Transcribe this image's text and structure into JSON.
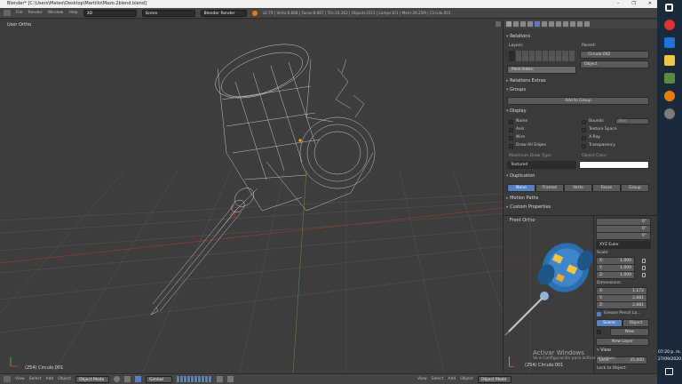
{
  "window": {
    "title": "Blender* [C:\\Users\\Mateo\\Desktop\\Martillo\\Mazo.2blend.blend]",
    "controls": [
      "–",
      "❐",
      "✕"
    ]
  },
  "menubar": {
    "items": [
      "File",
      "Render",
      "Window",
      "Help"
    ],
    "screen_layout": "3D",
    "scene": "Scene",
    "render_engine": "Blender Render",
    "version_icon": "blender-logo-icon",
    "stats": "v2.79 | Verts:8,888 | Faces:8,687 | Tris:16,362 | Objects:0/23 | Lamps:0/1 | Mem:39.25M | Circulo.001"
  },
  "viewport": {
    "view_label": "User Ortho",
    "object_label": "(254) Circulo.001"
  },
  "toolbar": {
    "items": [
      "View",
      "Select",
      "Add",
      "Object"
    ],
    "mode": "Object Mode",
    "orientation": "Gimbal"
  },
  "properties": {
    "sections": {
      "relations": "Relations",
      "relations_extras": "Relations Extras",
      "groups": "Groups",
      "display": "Display",
      "duplication": "Duplication",
      "motion_paths": "Motion Paths",
      "custom_properties": "Custom Properties"
    },
    "layers_label": "Layers:",
    "parent_label": "Parent:",
    "parent_value": "Circulo.002",
    "parent_type": "Object",
    "pass_index": "Pass Index:",
    "pass_index_value": "0",
    "add_to_group": "Add to Group",
    "display_options": {
      "name": "Name",
      "axis": "Axis",
      "wire": "Wire",
      "draw_all_edges": "Draw All Edges",
      "bounds": "Bounds",
      "bounds_type": "Box",
      "texture_space": "Texture Space",
      "xray": "X-Ray",
      "transparency": "Transparency"
    },
    "max_draw_type_label": "Maximum Draw Type:",
    "max_draw_type": "Textured",
    "object_color_label": "Object Color:",
    "duplication_buttons": [
      "None",
      "Frames",
      "Verts",
      "Faces",
      "Group"
    ],
    "duplication_active": "None"
  },
  "ortho_view": {
    "view_label": "Front Ortho",
    "object_label": "(254) Circulo.001"
  },
  "side_panel": {
    "rotation_values": [
      "0°",
      "0°",
      "0°"
    ],
    "rotation_mode": "XYZ Euler",
    "scale_label": "Scale:",
    "scale": [
      {
        "axis": "X:",
        "value": "1.000"
      },
      {
        "axis": "Y:",
        "value": "1.000"
      },
      {
        "axis": "Z:",
        "value": "1.000"
      }
    ],
    "dimensions_label": "Dimensions:",
    "dimensions": [
      {
        "axis": "X:",
        "value": "1.172"
      },
      {
        "axis": "Y:",
        "value": "2.881"
      },
      {
        "axis": "Z:",
        "value": "2.881"
      }
    ],
    "grease_pencil": "Grease Pencil La...",
    "gp_tabs": [
      "Scene",
      "Object"
    ],
    "gp_new": "New",
    "gp_new_layer": "New Layer",
    "view_section": "View",
    "lens_label": "Lens:",
    "lens_value": "35.000",
    "lock_to_object": "Lock to Object:"
  },
  "watermark": {
    "line1": "Activar Windows",
    "line2": "Ve a Configuración para activar Windows."
  },
  "taskbar": {
    "time": "07:20 p. m.",
    "date": "27/09/2020"
  },
  "colors": {
    "accent": "#5680c2",
    "grid_x": "#8a3b3b",
    "grid_y": "#5a8a3b",
    "wire": "#d8d8d8"
  }
}
